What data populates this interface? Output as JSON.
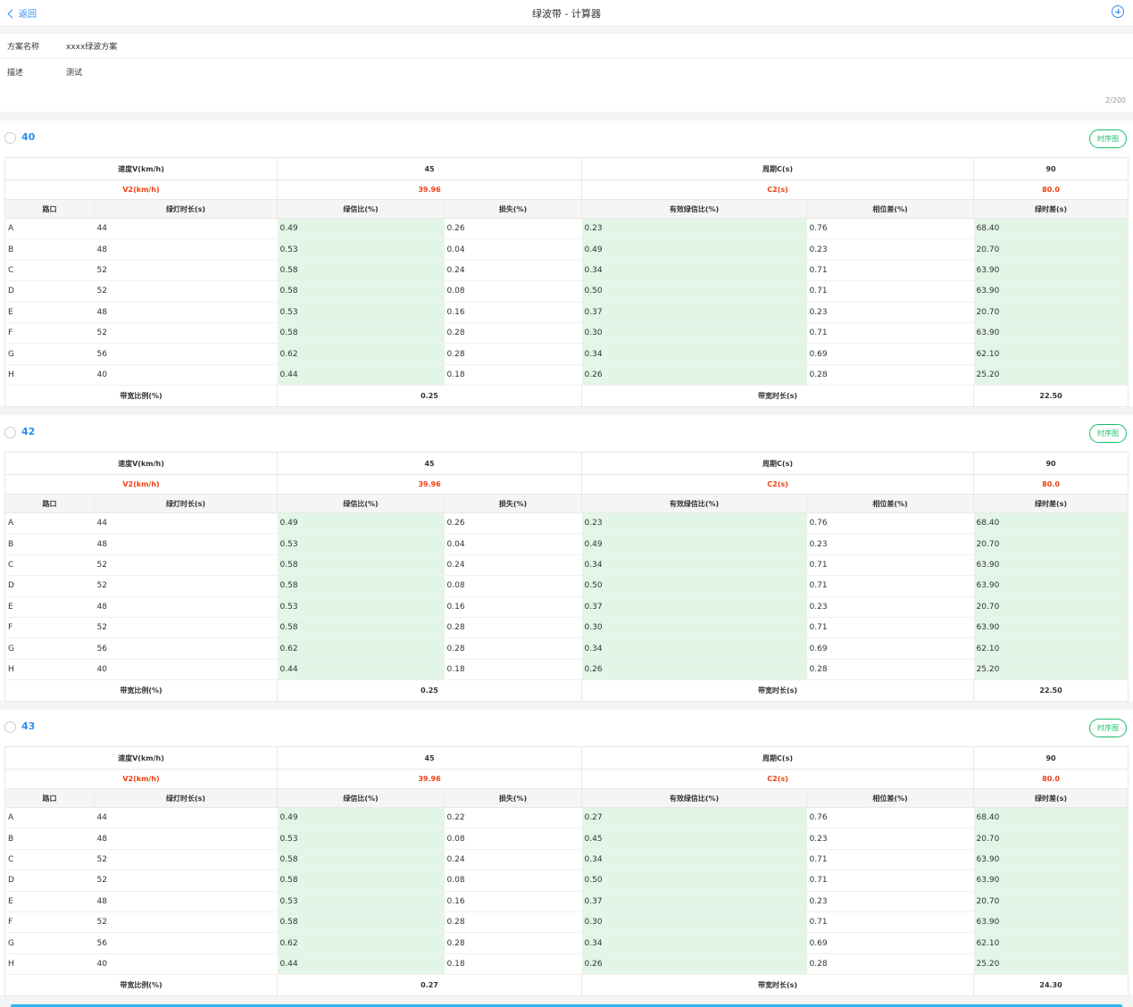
{
  "header": {
    "back_label": "返回",
    "title": "绿波带 - 计算器"
  },
  "form": {
    "name_label": "方案名称",
    "name_value": "xxxx绿波方案",
    "desc_label": "描述",
    "desc_value": "测试",
    "counter": "2/200"
  },
  "timing_button_label": "时序图",
  "columns": [
    "路口",
    "绿灯时长(s)",
    "绿信比(%)",
    "损失(%)",
    "有效绿信比(%)",
    "相位差(%)",
    "绿时差(s)"
  ],
  "labels": {
    "speed": "速度V(km/h)",
    "cycle": "周期C(s)",
    "v2": "V2(km/h)",
    "c2": "C2(s)",
    "band_ratio": "带宽比例(%)",
    "band_time": "带宽时长(s)"
  },
  "plans": [
    {
      "id": "40",
      "speed": "45",
      "cycle": "90",
      "v2": "39.96",
      "c2": "80.0",
      "band_ratio": "0.25",
      "band_time": "22.50",
      "rows": [
        [
          "A",
          "44",
          "0.49",
          "0.26",
          "0.23",
          "0.76",
          "68.40"
        ],
        [
          "B",
          "48",
          "0.53",
          "0.04",
          "0.49",
          "0.23",
          "20.70"
        ],
        [
          "C",
          "52",
          "0.58",
          "0.24",
          "0.34",
          "0.71",
          "63.90"
        ],
        [
          "D",
          "52",
          "0.58",
          "0.08",
          "0.50",
          "0.71",
          "63.90"
        ],
        [
          "E",
          "48",
          "0.53",
          "0.16",
          "0.37",
          "0.23",
          "20.70"
        ],
        [
          "F",
          "52",
          "0.58",
          "0.28",
          "0.30",
          "0.71",
          "63.90"
        ],
        [
          "G",
          "56",
          "0.62",
          "0.28",
          "0.34",
          "0.69",
          "62.10"
        ],
        [
          "H",
          "40",
          "0.44",
          "0.18",
          "0.26",
          "0.28",
          "25.20"
        ]
      ]
    },
    {
      "id": "42",
      "speed": "45",
      "cycle": "90",
      "v2": "39.96",
      "c2": "80.0",
      "band_ratio": "0.25",
      "band_time": "22.50",
      "rows": [
        [
          "A",
          "44",
          "0.49",
          "0.26",
          "0.23",
          "0.76",
          "68.40"
        ],
        [
          "B",
          "48",
          "0.53",
          "0.04",
          "0.49",
          "0.23",
          "20.70"
        ],
        [
          "C",
          "52",
          "0.58",
          "0.24",
          "0.34",
          "0.71",
          "63.90"
        ],
        [
          "D",
          "52",
          "0.58",
          "0.08",
          "0.50",
          "0.71",
          "63.90"
        ],
        [
          "E",
          "48",
          "0.53",
          "0.16",
          "0.37",
          "0.23",
          "20.70"
        ],
        [
          "F",
          "52",
          "0.58",
          "0.28",
          "0.30",
          "0.71",
          "63.90"
        ],
        [
          "G",
          "56",
          "0.62",
          "0.28",
          "0.34",
          "0.69",
          "62.10"
        ],
        [
          "H",
          "40",
          "0.44",
          "0.18",
          "0.26",
          "0.28",
          "25.20"
        ]
      ]
    },
    {
      "id": "43",
      "speed": "45",
      "cycle": "90",
      "v2": "39.96",
      "c2": "80.0",
      "band_ratio": "0.27",
      "band_time": "24.30",
      "rows": [
        [
          "A",
          "44",
          "0.49",
          "0.22",
          "0.27",
          "0.76",
          "68.40"
        ],
        [
          "B",
          "48",
          "0.53",
          "0.08",
          "0.45",
          "0.23",
          "20.70"
        ],
        [
          "C",
          "52",
          "0.58",
          "0.24",
          "0.34",
          "0.71",
          "63.90"
        ],
        [
          "D",
          "52",
          "0.58",
          "0.08",
          "0.50",
          "0.71",
          "63.90"
        ],
        [
          "E",
          "48",
          "0.53",
          "0.16",
          "0.37",
          "0.23",
          "20.70"
        ],
        [
          "F",
          "52",
          "0.58",
          "0.28",
          "0.30",
          "0.71",
          "63.90"
        ],
        [
          "G",
          "56",
          "0.62",
          "0.28",
          "0.34",
          "0.69",
          "62.10"
        ],
        [
          "H",
          "40",
          "0.44",
          "0.18",
          "0.26",
          "0.28",
          "25.20"
        ]
      ]
    }
  ]
}
